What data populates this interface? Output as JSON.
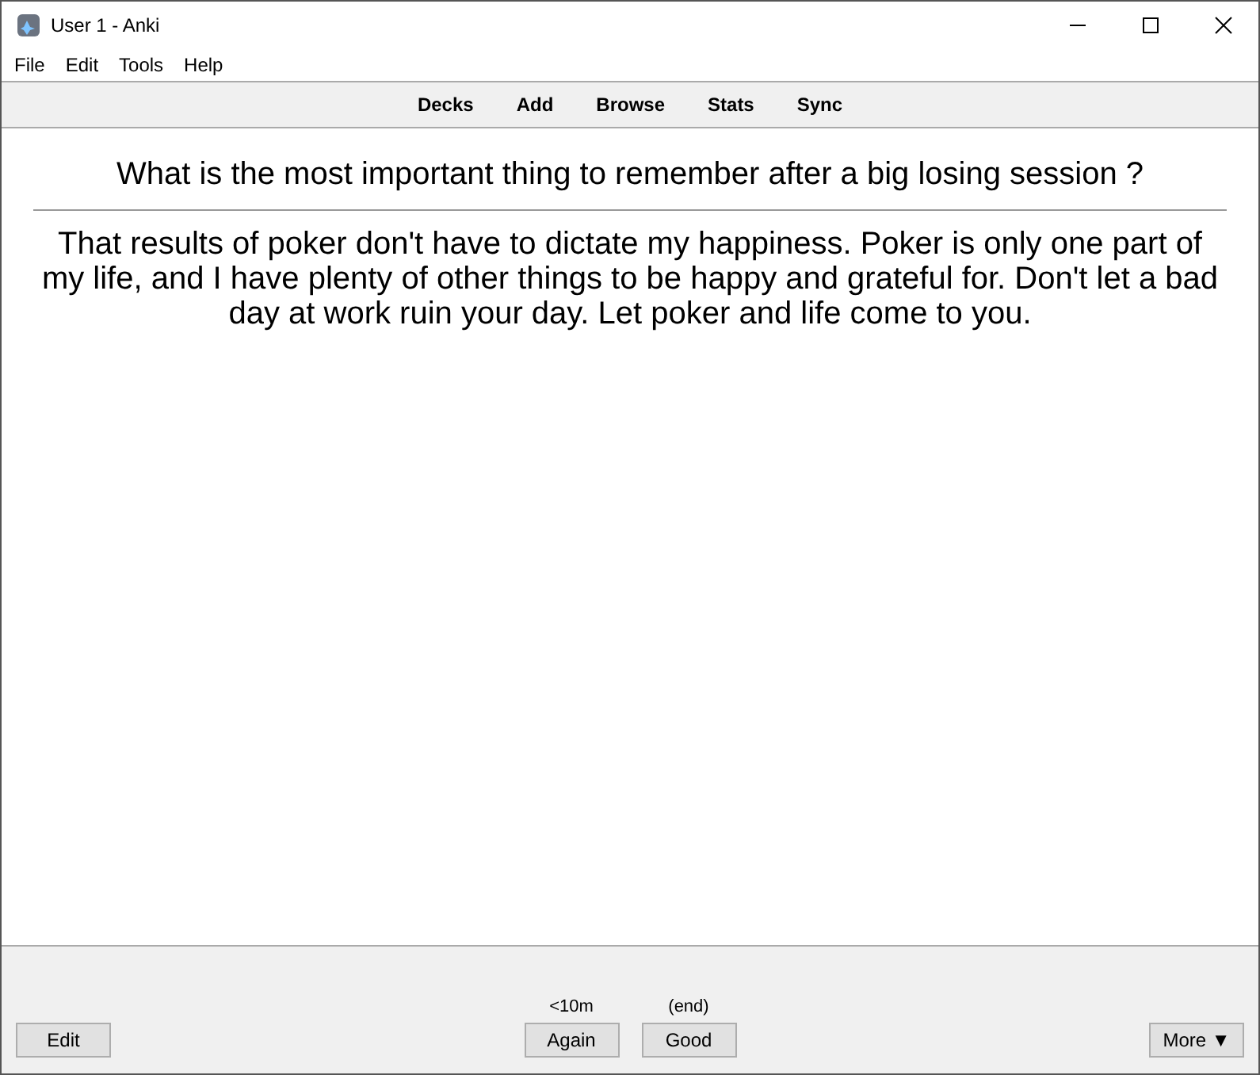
{
  "window": {
    "title": "User 1 - Anki"
  },
  "menu": [
    "File",
    "Edit",
    "Tools",
    "Help"
  ],
  "toolbar": [
    "Decks",
    "Add",
    "Browse",
    "Stats",
    "Sync"
  ],
  "card": {
    "question": "What is the most important thing to remember after a big losing session ?",
    "answer": "That results of poker don't have to dictate my happiness. Poker is only one part of my life, and I have plenty of other things to be happy and grateful for. Don't let a bad day at work ruin your day. Let poker and life come to you."
  },
  "bottom": {
    "edit": "Edit",
    "answers": [
      {
        "interval": "<10m",
        "label": "Again"
      },
      {
        "interval": "(end)",
        "label": "Good"
      }
    ],
    "more": "More ▼"
  }
}
